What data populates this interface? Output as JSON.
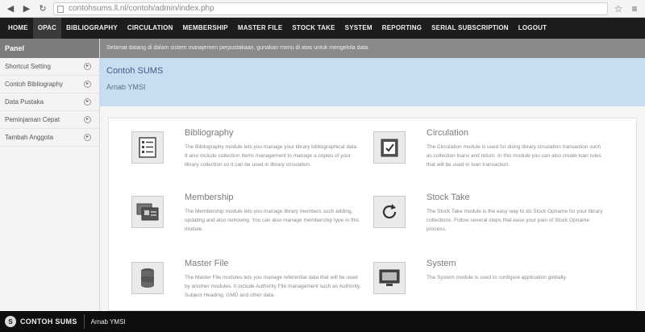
{
  "browser": {
    "back_icon": "back-arrow-icon",
    "forward_icon": "forward-arrow-icon",
    "reload_icon": "reload-icon",
    "url": "contohsums.ll.nl/contoh/admin/index.php",
    "star_icon": "star-icon",
    "menu_icon": "menu-icon"
  },
  "topnav": {
    "items": [
      {
        "label": "Home"
      },
      {
        "label": "OPAC"
      },
      {
        "label": "Bibliography"
      },
      {
        "label": "Circulation"
      },
      {
        "label": "Membership"
      },
      {
        "label": "Master File"
      },
      {
        "label": "Stock Take"
      },
      {
        "label": "System"
      },
      {
        "label": "Reporting"
      },
      {
        "label": "Serial Subscription"
      },
      {
        "label": "Logout"
      }
    ],
    "active_index": 1
  },
  "sidebar": {
    "header": "Panel",
    "items": [
      {
        "label": "Shortcut Setting"
      },
      {
        "label": "Contoh Bibliography"
      },
      {
        "label": "Data Pustaka"
      },
      {
        "label": "Peminjaman Cepat"
      },
      {
        "label": "Tambah Anggota"
      }
    ]
  },
  "notice": {
    "text": "Selamat datang di dalam sistem manajemen perpustakaan, gunakan menu di atas untuk mengelola data."
  },
  "banner": {
    "title": "Contoh SUMS",
    "subtitle": "Arnab YMSI"
  },
  "modules": [
    {
      "title": "Bibliography",
      "icon": "list-document-icon",
      "description": "The Bibliography module lets you manage your library bibliographical data. It also include collection items management to manage a copies of your library collection so it can be used in library circulation."
    },
    {
      "title": "Circulation",
      "icon": "checklist-icon",
      "description": "The Circulation module is used for doing library circulation transaction such as collection loans and return. In this module you can also create loan rules that will be used in loan transaction."
    },
    {
      "title": "Membership",
      "icon": "member-cards-icon",
      "description": "The Membership module lets you manage library members such adding, updating and also removing. You can also manage membership type in this module."
    },
    {
      "title": "Stock Take",
      "icon": "refresh-cycle-icon",
      "description": "The Stock Take module is the easy way to do Stock Opname for your library collections. Follow several steps that ease your pain of Stock Opname process."
    },
    {
      "title": "Master File",
      "icon": "database-icon",
      "description": "The Master File modules lets you manage referential data that will be used by another modules. It include Authority File management such as Authority, Subject Heading, GMD and other data."
    },
    {
      "title": "System",
      "icon": "monitor-icon",
      "description": "The System module is used to configure application globally."
    }
  ],
  "footer": {
    "logo_letter": "S",
    "brand": "CONTOH SUMS",
    "user": "Arnab YMSI"
  }
}
